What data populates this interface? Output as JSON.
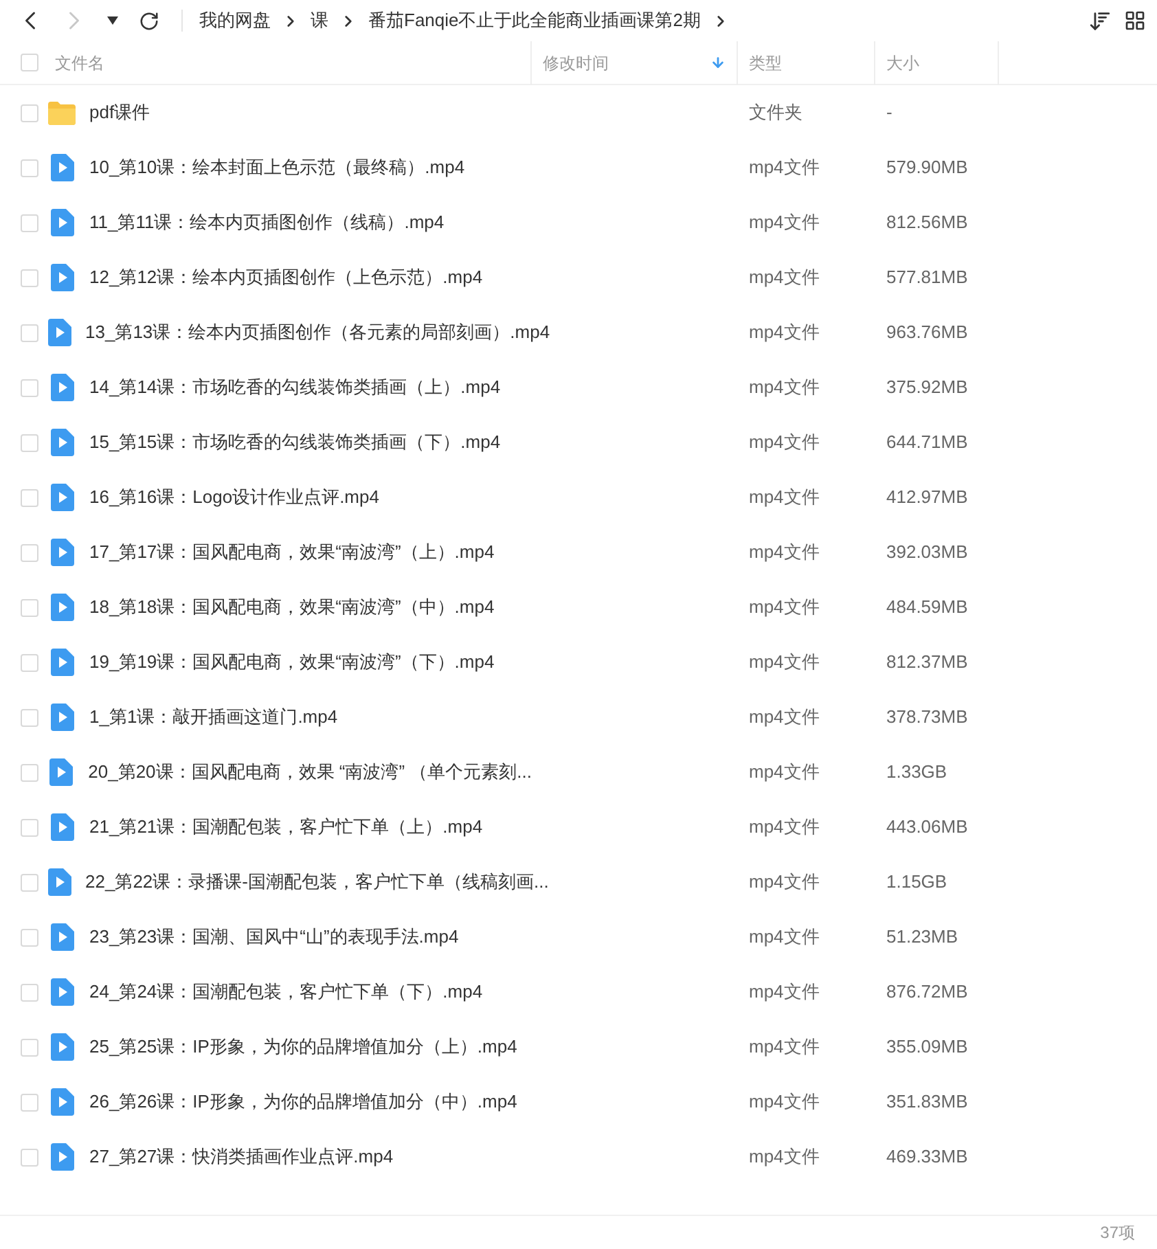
{
  "nav": [
    {
      "kind": "back",
      "disabled": false
    },
    {
      "kind": "forward",
      "disabled": true
    },
    {
      "kind": "dropdown",
      "disabled": false
    },
    {
      "kind": "refresh",
      "disabled": false
    }
  ],
  "breadcrumb": [
    "我的网盘",
    "课",
    "番茄Fanqie不止于此全能商业插画课第2期"
  ],
  "columns": [
    {
      "label": "文件名",
      "sorted": false
    },
    {
      "label": "修改时间",
      "sorted": true
    },
    {
      "label": "类型",
      "sorted": false
    },
    {
      "label": "大小",
      "sorted": false
    }
  ],
  "rows": [
    {
      "kind": "folder",
      "name": "pdf课件",
      "type": "文件夹",
      "size": "-",
      "checked": false
    },
    {
      "kind": "video",
      "name": "10_第10课：绘本封面上色示范（最终稿）.mp4",
      "type": "mp4文件",
      "size": "579.90MB",
      "checked": false
    },
    {
      "kind": "video",
      "name": "11_第11课：绘本内页插图创作（线稿）.mp4",
      "type": "mp4文件",
      "size": "812.56MB",
      "checked": false
    },
    {
      "kind": "video",
      "name": "12_第12课：绘本内页插图创作（上色示范）.mp4",
      "type": "mp4文件",
      "size": "577.81MB",
      "checked": false
    },
    {
      "kind": "video",
      "name": "13_第13课：绘本内页插图创作（各元素的局部刻画）.mp4",
      "type": "mp4文件",
      "size": "963.76MB",
      "checked": false
    },
    {
      "kind": "video",
      "name": "14_第14课：市场吃香的勾线装饰类插画（上）.mp4",
      "type": "mp4文件",
      "size": "375.92MB",
      "checked": false
    },
    {
      "kind": "video",
      "name": "15_第15课：市场吃香的勾线装饰类插画（下）.mp4",
      "type": "mp4文件",
      "size": "644.71MB",
      "checked": false
    },
    {
      "kind": "video",
      "name": "16_第16课：Logo设计作业点评.mp4",
      "type": "mp4文件",
      "size": "412.97MB",
      "checked": false
    },
    {
      "kind": "video",
      "name": "17_第17课：国风配电商，效果“南波湾”（上）.mp4",
      "type": "mp4文件",
      "size": "392.03MB",
      "checked": false
    },
    {
      "kind": "video",
      "name": "18_第18课：国风配电商，效果“南波湾”（中）.mp4",
      "type": "mp4文件",
      "size": "484.59MB",
      "checked": false
    },
    {
      "kind": "video",
      "name": "19_第19课：国风配电商，效果“南波湾”（下）.mp4",
      "type": "mp4文件",
      "size": "812.37MB",
      "checked": false
    },
    {
      "kind": "video",
      "name": "1_第1课：敲开插画这道门.mp4",
      "type": "mp4文件",
      "size": "378.73MB",
      "checked": false
    },
    {
      "kind": "video",
      "name": "20_第20课：国风配电商，效果 “南波湾” （单个元素刻...",
      "type": "mp4文件",
      "size": "1.33GB",
      "checked": false
    },
    {
      "kind": "video",
      "name": "21_第21课：国潮配包装，客户忙下单（上）.mp4",
      "type": "mp4文件",
      "size": "443.06MB",
      "checked": false
    },
    {
      "kind": "video",
      "name": "22_第22课：录播课-国潮配包装，客户忙下单（线稿刻画...",
      "type": "mp4文件",
      "size": "1.15GB",
      "checked": false
    },
    {
      "kind": "video",
      "name": "23_第23课：国潮、国风中“山”的表现手法.mp4",
      "type": "mp4文件",
      "size": "51.23MB",
      "checked": false
    },
    {
      "kind": "video",
      "name": "24_第24课：国潮配包装，客户忙下单（下）.mp4",
      "type": "mp4文件",
      "size": "876.72MB",
      "checked": false
    },
    {
      "kind": "video",
      "name": "25_第25课：IP形象，为你的品牌增值加分（上）.mp4",
      "type": "mp4文件",
      "size": "355.09MB",
      "checked": false
    },
    {
      "kind": "video",
      "name": "26_第26课：IP形象，为你的品牌增值加分（中）.mp4",
      "type": "mp4文件",
      "size": "351.83MB",
      "checked": false
    },
    {
      "kind": "video",
      "name": "27_第27课：快消类插画作业点评.mp4",
      "type": "mp4文件",
      "size": "469.33MB",
      "checked": false
    }
  ],
  "select_all": {
    "checked": false
  },
  "status_bar": {
    "count": "37项"
  }
}
